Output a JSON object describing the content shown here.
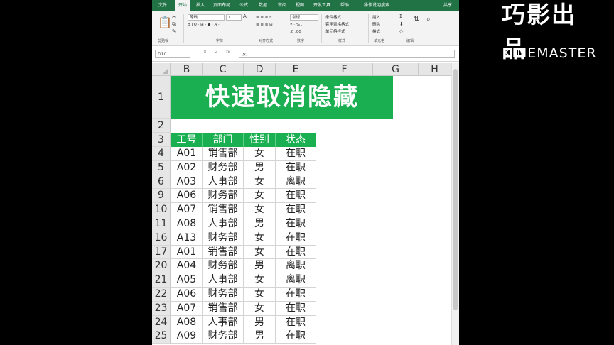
{
  "ribbon": {
    "tabs": [
      "文件",
      "开始",
      "插入",
      "页面布局",
      "公式",
      "数据",
      "审阅",
      "视图",
      "开发工具",
      "帮助",
      "操作说明搜索"
    ],
    "active_tab": "开始",
    "share": "共享",
    "font_name": "等线",
    "font_size": "11",
    "number_format": "常规",
    "groups": [
      "剪贴板",
      "字体",
      "对齐方式",
      "数字",
      "样式",
      "单元格",
      "编辑"
    ],
    "style_items": [
      "条件格式",
      "套用表格格式",
      "单元格样式"
    ],
    "cell_items": [
      "插入",
      "删除",
      "格式"
    ]
  },
  "formula_bar": {
    "name_box": "D10",
    "content": "女"
  },
  "sheet": {
    "columns": [
      "B",
      "C",
      "D",
      "E",
      "F",
      "G",
      "H"
    ],
    "title": "快速取消隐藏",
    "header_row": {
      "row": "3",
      "cells": [
        "工号",
        "部门",
        "性别",
        "状态"
      ]
    },
    "rows": [
      {
        "row": "4",
        "cells": [
          "A01",
          "销售部",
          "女",
          "在职"
        ]
      },
      {
        "row": "5",
        "cells": [
          "A02",
          "财务部",
          "男",
          "在职"
        ]
      },
      {
        "row": "6",
        "cells": [
          "A03",
          "人事部",
          "女",
          "离职"
        ]
      },
      {
        "row": "9",
        "cells": [
          "A06",
          "财务部",
          "女",
          "在职"
        ]
      },
      {
        "row": "10",
        "cells": [
          "A07",
          "销售部",
          "女",
          "在职"
        ]
      },
      {
        "row": "11",
        "cells": [
          "A08",
          "人事部",
          "男",
          "在职"
        ]
      },
      {
        "row": "16",
        "cells": [
          "A13",
          "财务部",
          "女",
          "在职"
        ]
      },
      {
        "row": "17",
        "cells": [
          "A01",
          "销售部",
          "女",
          "在职"
        ]
      },
      {
        "row": "20",
        "cells": [
          "A04",
          "财务部",
          "男",
          "离职"
        ]
      },
      {
        "row": "21",
        "cells": [
          "A05",
          "人事部",
          "女",
          "离职"
        ]
      },
      {
        "row": "22",
        "cells": [
          "A06",
          "财务部",
          "女",
          "在职"
        ]
      },
      {
        "row": "23",
        "cells": [
          "A07",
          "销售部",
          "女",
          "在职"
        ]
      },
      {
        "row": "24",
        "cells": [
          "A08",
          "人事部",
          "男",
          "在职"
        ]
      },
      {
        "row": "25",
        "cells": [
          "A09",
          "财务部",
          "男",
          "在职"
        ]
      }
    ],
    "title_rows": [
      "1",
      "2"
    ]
  },
  "watermark": {
    "top": "巧影出品",
    "bottom": "KINEMASTER"
  },
  "colors": {
    "excel_green": "#217346",
    "table_green": "#1ab051"
  }
}
